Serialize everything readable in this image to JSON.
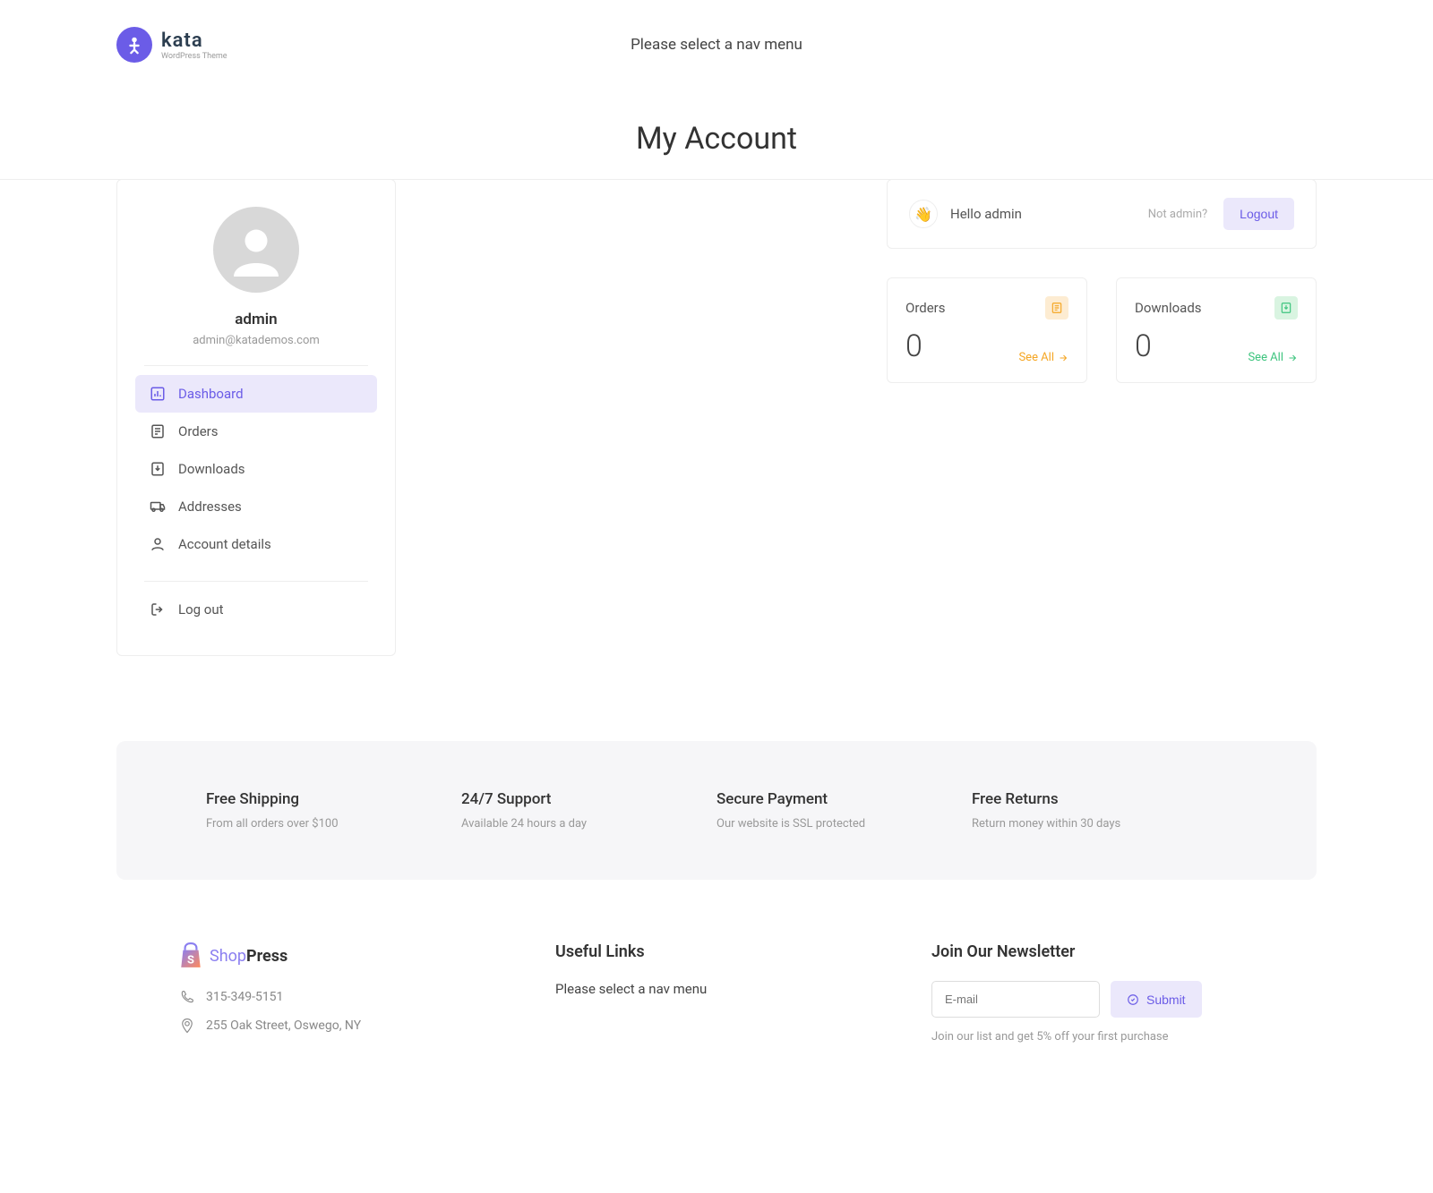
{
  "header": {
    "logo_name": "kata",
    "logo_sub": "WordPress Theme",
    "nav_msg": "Please select a nav menu"
  },
  "page_title": "My Account",
  "sidebar": {
    "user_name": "admin",
    "user_email": "admin@katademos.com",
    "nav": [
      {
        "label": "Dashboard"
      },
      {
        "label": "Orders"
      },
      {
        "label": "Downloads"
      },
      {
        "label": "Addresses"
      },
      {
        "label": "Account details"
      }
    ],
    "logout": "Log out"
  },
  "hello": {
    "greeting": "Hello admin",
    "not_user": "Not admin?",
    "logout": "Logout"
  },
  "stats": {
    "orders": {
      "title": "Orders",
      "count": "0",
      "see_all": "See All"
    },
    "downloads": {
      "title": "Downloads",
      "count": "0",
      "see_all": "See All"
    }
  },
  "features": [
    {
      "title": "Free Shipping",
      "sub": "From all orders over $100"
    },
    {
      "title": "24/7 Support",
      "sub": "Available 24 hours a day"
    },
    {
      "title": "Secure Payment",
      "sub": "Our website is SSL protected"
    },
    {
      "title": "Free Returns",
      "sub": "Return money within 30 days"
    }
  ],
  "footer": {
    "brand1": "Shop",
    "brand2": "Press",
    "phone": "315-349-5151",
    "address": "255 Oak Street, Oswego, NY",
    "links_title": "Useful Links",
    "links_msg": "Please select a nav menu",
    "newsletter_title": "Join Our Newsletter",
    "email_placeholder": "E-mail",
    "submit": "Submit",
    "newsletter_sub": "Join our list and get 5% off your first purchase"
  }
}
